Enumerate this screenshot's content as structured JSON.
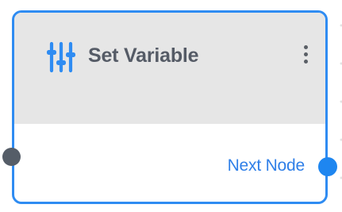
{
  "node": {
    "title": "Set Variable",
    "icon": "sliders-icon",
    "menu_icon": "more-vertical-icon",
    "output_label": "Next Node"
  },
  "colors": {
    "accent": "#2f8cf2",
    "header_bg": "#e6e6e6",
    "title_text": "#555b66",
    "input_port": "#555d68",
    "output_port": "#1e86f0",
    "output_label": "#2f7fe8"
  }
}
